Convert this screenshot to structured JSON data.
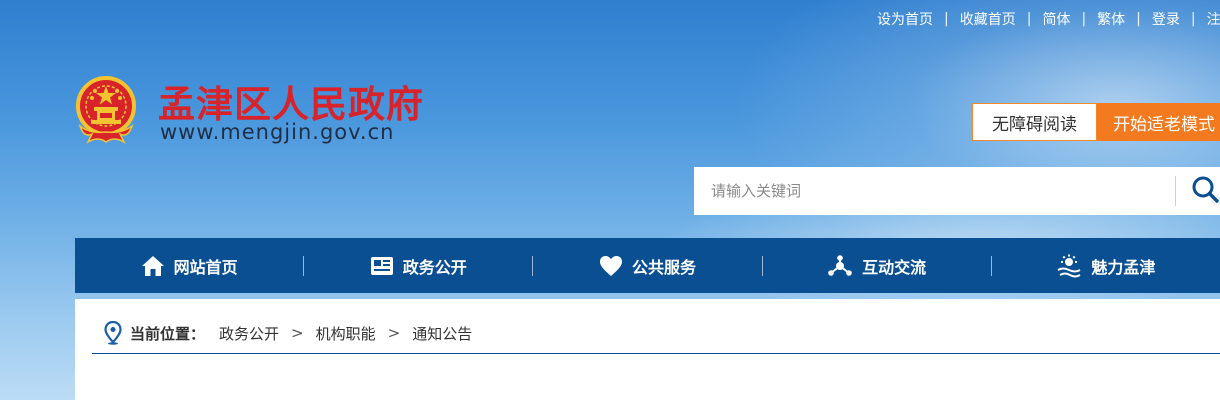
{
  "top_links": {
    "set_home": "设为首页",
    "favorite": "收藏首页",
    "simplified": "简体",
    "traditional": "繁体",
    "login": "登录",
    "register_partial": "注",
    "separator": "|"
  },
  "header": {
    "title": "孟津区人民政府",
    "url": "www.mengjin.gov.cn",
    "emblem_icon": "national-emblem-icon"
  },
  "accessibility": {
    "barrier_free": "无障碍阅读",
    "elder_mode": "开始适老模式"
  },
  "search": {
    "placeholder": "请输入关键词",
    "icon": "search-icon"
  },
  "nav": {
    "items": [
      {
        "label": "网站首页",
        "icon": "home-icon"
      },
      {
        "label": "政务公开",
        "icon": "document-icon"
      },
      {
        "label": "公共服务",
        "icon": "heart-icon"
      },
      {
        "label": "互动交流",
        "icon": "network-icon"
      },
      {
        "label": "魅力孟津",
        "icon": "scenery-icon"
      }
    ]
  },
  "breadcrumb": {
    "label": "当前位置：",
    "items": [
      "政务公开",
      "机构职能",
      "通知公告"
    ],
    "arrow": ">"
  },
  "colors": {
    "title_red": "#d8232a",
    "nav_blue": "#0b4f93",
    "elder_orange": "#f37a1f"
  }
}
